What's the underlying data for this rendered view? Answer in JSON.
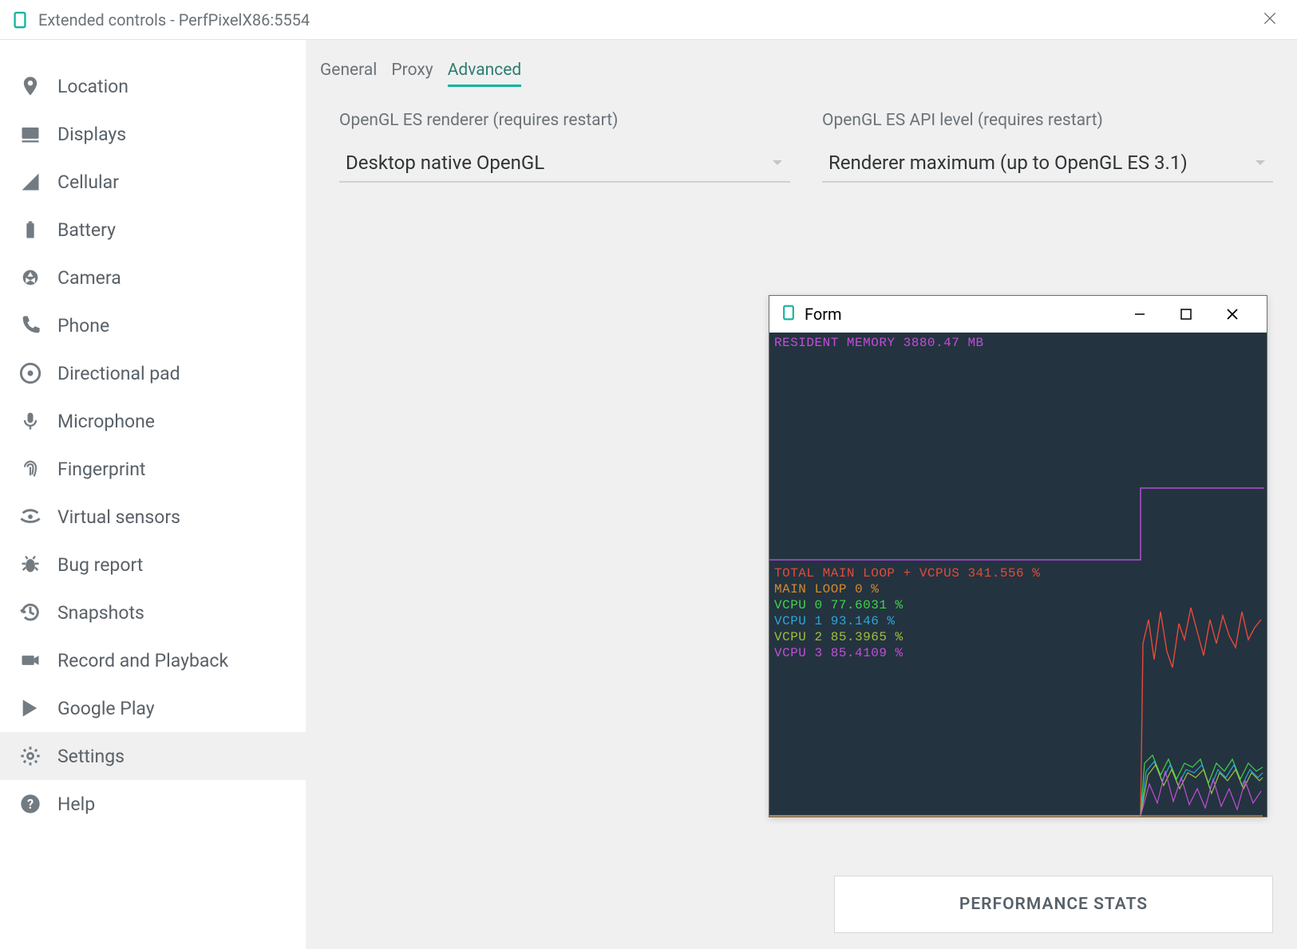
{
  "window_title": "Extended controls - PerfPixelX86:5554",
  "sidebar": {
    "items": [
      {
        "label": "Location"
      },
      {
        "label": "Displays"
      },
      {
        "label": "Cellular"
      },
      {
        "label": "Battery"
      },
      {
        "label": "Camera"
      },
      {
        "label": "Phone"
      },
      {
        "label": "Directional pad"
      },
      {
        "label": "Microphone"
      },
      {
        "label": "Fingerprint"
      },
      {
        "label": "Virtual sensors"
      },
      {
        "label": "Bug report"
      },
      {
        "label": "Snapshots"
      },
      {
        "label": "Record and Playback"
      },
      {
        "label": "Google Play"
      },
      {
        "label": "Settings"
      },
      {
        "label": "Help"
      }
    ]
  },
  "tabs": {
    "general": "General",
    "proxy": "Proxy",
    "advanced": "Advanced"
  },
  "fields": {
    "renderer_label": "OpenGL ES renderer (requires restart)",
    "renderer_value": "Desktop native OpenGL",
    "api_label": "OpenGL ES API level (requires restart)",
    "api_value": "Renderer maximum (up to OpenGL ES 3.1)"
  },
  "perf_button": "PERFORMANCE STATS",
  "form": {
    "title": "Form",
    "mem_line": "RESIDENT MEMORY 3880.47 MB",
    "cpu_lines": {
      "total": "TOTAL MAIN LOOP + VCPUS 341.556 %",
      "main": "MAIN LOOP 0 %",
      "v0": "VCPU 0 77.6031 %",
      "v1": "VCPU 1 93.146 %",
      "v2": "VCPU 2 85.3965 %",
      "v3": "VCPU 3 85.4109 %"
    }
  },
  "chart_data": [
    {
      "type": "line",
      "title": "Resident memory (MB)",
      "series": [
        {
          "name": "RESIDENT MEMORY",
          "color": "#c24dd8",
          "values": [
            4100,
            4100,
            4100,
            4100,
            4100,
            4100,
            4100,
            4100,
            3880,
            3880
          ]
        }
      ],
      "ylim": [
        0,
        8000
      ]
    },
    {
      "type": "line",
      "title": "CPU usage %",
      "ylim": [
        0,
        400
      ],
      "series": [
        {
          "name": "TOTAL MAIN LOOP + VCPUS",
          "color": "#e54a3a",
          "values": [
            0,
            0,
            0,
            0,
            0,
            0,
            0,
            0,
            340,
            360,
            330,
            350,
            335,
            342
          ]
        },
        {
          "name": "MAIN LOOP",
          "color": "#d58b2a",
          "values": [
            0,
            0,
            0,
            0,
            0,
            0,
            0,
            0,
            0,
            0,
            0,
            0,
            0,
            0
          ]
        },
        {
          "name": "VCPU 0",
          "color": "#3fd44b",
          "values": [
            0,
            0,
            0,
            0,
            0,
            0,
            0,
            0,
            78,
            82,
            75,
            80,
            72,
            78
          ]
        },
        {
          "name": "VCPU 1",
          "color": "#2aa7d6",
          "values": [
            0,
            0,
            0,
            0,
            0,
            0,
            0,
            0,
            90,
            95,
            88,
            94,
            92,
            93
          ]
        },
        {
          "name": "VCPU 2",
          "color": "#9fbf3a",
          "values": [
            0,
            0,
            0,
            0,
            0,
            0,
            0,
            0,
            84,
            88,
            82,
            86,
            80,
            85
          ]
        },
        {
          "name": "VCPU 3",
          "color": "#c24dd8",
          "values": [
            0,
            0,
            0,
            0,
            0,
            0,
            0,
            0,
            86,
            90,
            80,
            88,
            78,
            85
          ]
        }
      ]
    }
  ]
}
